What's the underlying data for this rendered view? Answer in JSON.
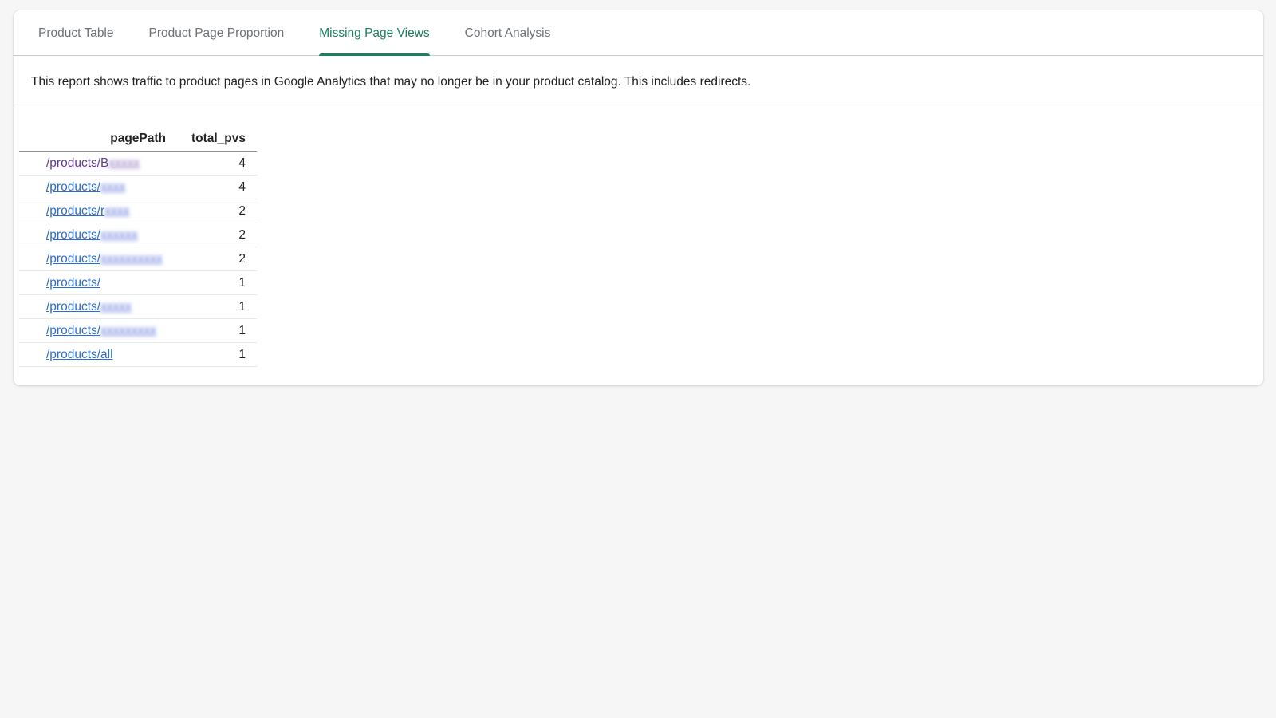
{
  "tabs": [
    {
      "label": "Product Table",
      "active": false
    },
    {
      "label": "Product Page Proportion",
      "active": false
    },
    {
      "label": "Missing Page Views",
      "active": true
    },
    {
      "label": "Cohort Analysis",
      "active": false
    }
  ],
  "description": "This report shows traffic to product pages in Google Analytics that may no longer be in your product catalog. This includes redirects.",
  "table": {
    "headers": [
      "pagePath",
      "total_pvs"
    ],
    "rows": [
      {
        "path": "/products/B",
        "redacted": "xxxxx",
        "pvs": "4",
        "visited": true
      },
      {
        "path": "/products/",
        "redacted": "xxxx",
        "pvs": "4",
        "visited": false
      },
      {
        "path": "/products/r",
        "redacted": "xxxx",
        "pvs": "2",
        "visited": false
      },
      {
        "path": "/products/",
        "redacted": "xxxxxx",
        "pvs": "2",
        "visited": false
      },
      {
        "path": "/products/",
        "redacted": "xxxxxxxxxx",
        "pvs": "2",
        "visited": false
      },
      {
        "path": "/products/",
        "redacted": "",
        "pvs": "1",
        "visited": false
      },
      {
        "path": "/products/",
        "redacted": "xxxxx",
        "pvs": "1",
        "visited": false
      },
      {
        "path": "/products/",
        "redacted": "xxxxxxxxx",
        "pvs": "1",
        "visited": false
      },
      {
        "path": "/products/all",
        "redacted": "",
        "pvs": "1",
        "visited": false
      }
    ]
  },
  "colors": {
    "accent": "#1a7f5a",
    "link": "#2c6ecb",
    "link_visited": "#5f3b8c",
    "background": "#f6f6f7"
  }
}
